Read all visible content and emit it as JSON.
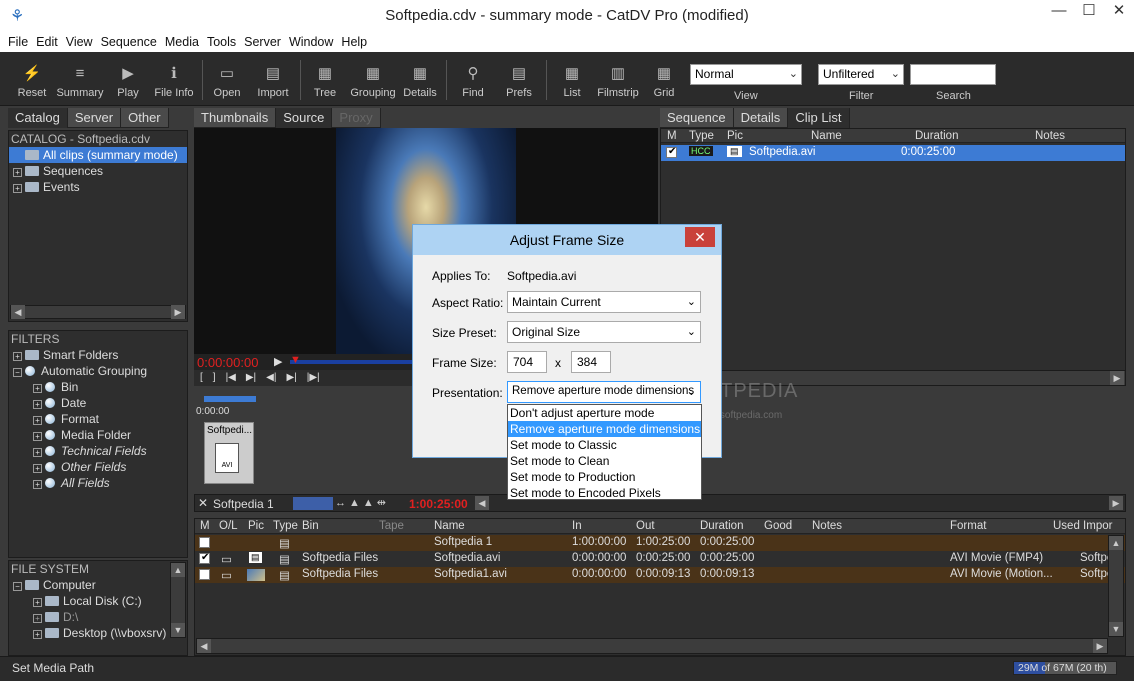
{
  "window": {
    "title": "Softpedia.cdv - summary mode - CatDV Pro (modified)"
  },
  "menu": [
    "File",
    "Edit",
    "View",
    "Sequence",
    "Media",
    "Tools",
    "Server",
    "Window",
    "Help"
  ],
  "toolbar": {
    "buttons": [
      "Reset",
      "Summary",
      "Play",
      "File Info",
      "Open",
      "Import",
      "Tree",
      "Grouping",
      "Details",
      "Find",
      "Prefs",
      "List",
      "Filmstrip",
      "Grid"
    ],
    "view_select": "Normal",
    "view_label": "View",
    "filter_select": "Unfiltered",
    "filter_label": "Filter",
    "search_value": "",
    "search_label": "Search"
  },
  "left_tabs": [
    "Catalog",
    "Server",
    "Other"
  ],
  "catalog": {
    "header": "CATALOG - Softpedia.cdv",
    "items": [
      "All clips (summary mode)",
      "Sequences",
      "Events"
    ]
  },
  "filters": {
    "header": "FILTERS",
    "smart_folders": "Smart Folders",
    "automatic_grouping": "Automatic Grouping",
    "groups": [
      "Bin",
      "Date",
      "Format",
      "Media Folder",
      "Technical Fields",
      "Other Fields",
      "All Fields"
    ]
  },
  "file_system": {
    "header": "FILE SYSTEM",
    "items": [
      "Computer",
      "Local Disk (C:)",
      "D:\\",
      "Desktop (\\\\vboxsrv)"
    ]
  },
  "center_tabs": [
    "Thumbnails",
    "Source",
    "Proxy"
  ],
  "player": {
    "timecode": "0:00:00:00",
    "mini_timecode": "0:00:00",
    "thumb_label": "Softpedi...",
    "thumb_icon": "AVI"
  },
  "right_tabs": [
    "Sequence",
    "Details",
    "Clip List"
  ],
  "clip_list": {
    "headers": [
      "M",
      "Type",
      "Pic",
      "Name",
      "Duration",
      "Notes"
    ],
    "row": {
      "name": "Softpedia.avi",
      "duration": "0:00:25:00",
      "type_badge": "HCC"
    }
  },
  "sequence_bar": {
    "name": "Softpedia 1",
    "timecode": "1:00:25:00"
  },
  "main_table": {
    "headers": [
      "M",
      "O/L",
      "Pic",
      "Type",
      "Bin",
      "Tape",
      "Name",
      "In",
      "Out",
      "Duration",
      "Good",
      "Notes",
      "Format",
      "Used Impor"
    ],
    "rows": [
      {
        "bin": "",
        "name": "Softpedia 1",
        "in": "1:00:00:00",
        "out": "1:00:25:00",
        "duration": "0:00:25:00",
        "format": "",
        "used": "",
        "checked": false
      },
      {
        "bin": "Softpedia Files",
        "name": "Softpedia.avi",
        "in": "0:00:00:00",
        "out": "0:00:25:00",
        "duration": "0:00:25:00",
        "format": "AVI Movie (FMP4)",
        "used": "Softpe",
        "checked": true
      },
      {
        "bin": "Softpedia Files",
        "name": "Softpedia1.avi",
        "in": "0:00:00:00",
        "out": "0:00:09:13",
        "duration": "0:00:09:13",
        "format": "AVI Movie (Motion...",
        "used": "Softpe",
        "checked": false
      }
    ]
  },
  "dialog": {
    "title": "Adjust Frame Size",
    "applies_to_label": "Applies To:",
    "applies_to_value": "Softpedia.avi",
    "aspect_label": "Aspect Ratio:",
    "aspect_value": "Maintain Current",
    "preset_label": "Size Preset:",
    "preset_value": "Original Size",
    "frame_label": "Frame Size:",
    "width": "704",
    "x": "x",
    "height": "384",
    "presentation_label": "Presentation:",
    "presentation_value": "Remove aperture mode dimensions",
    "options": [
      "Don't adjust aperture mode",
      "Remove aperture mode dimensions",
      "Set mode to Classic",
      "Set mode to Clean",
      "Set mode to Production",
      "Set mode to Encoded Pixels"
    ]
  },
  "watermark": {
    "text": "SOFTPEDIA",
    "url": "www.softpedia.com"
  },
  "status": {
    "left": "Set Media Path",
    "memory": "29M of 67M (20 th)"
  }
}
